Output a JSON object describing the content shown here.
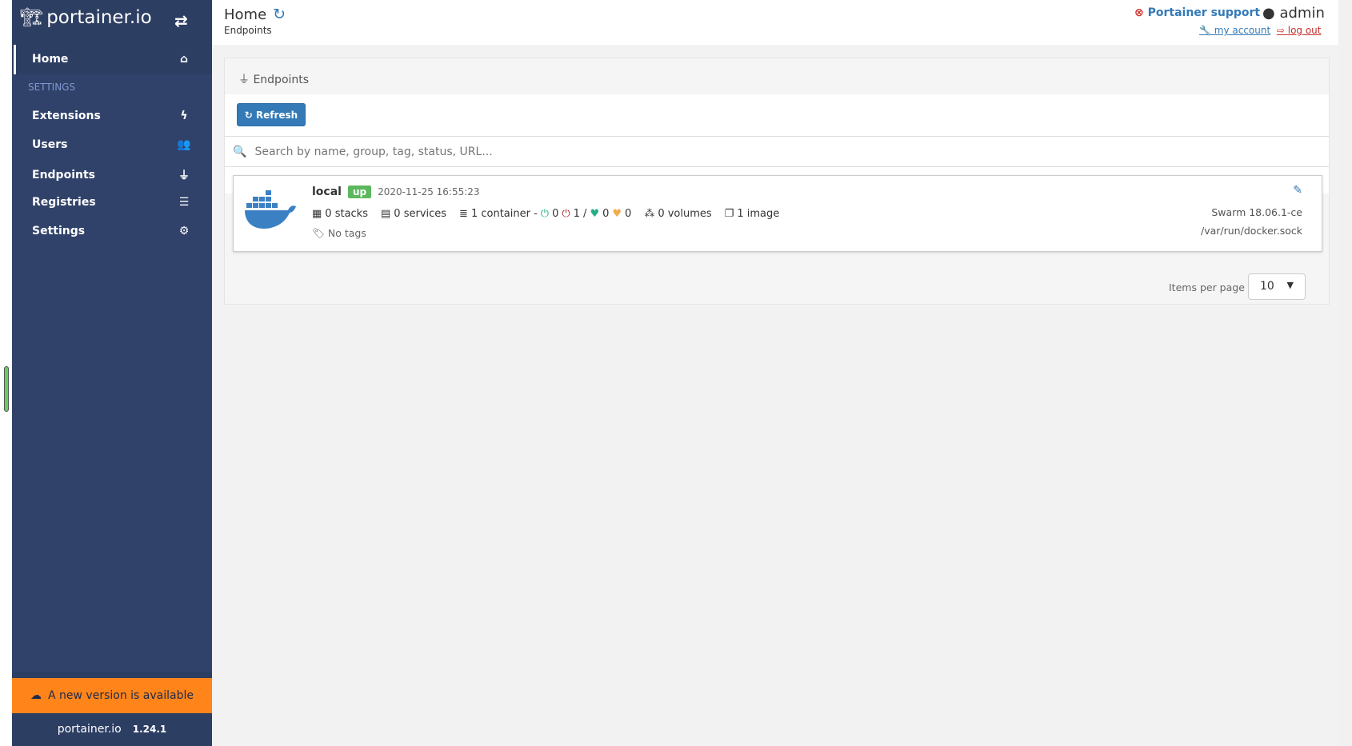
{
  "sidebar": {
    "logo": "portainer.io",
    "home": "Home",
    "section": "SETTINGS",
    "items": [
      {
        "label": "Extensions",
        "icon": "bolt-icon"
      },
      {
        "label": "Users",
        "icon": "users-icon"
      },
      {
        "label": "Endpoints",
        "icon": "plug-icon"
      },
      {
        "label": "Registries",
        "icon": "database-icon"
      },
      {
        "label": "Settings",
        "icon": "cogs-icon"
      }
    ],
    "update_banner": "A new version is available",
    "footer_logo": "portainer.io",
    "version": "1.24.1"
  },
  "header": {
    "title": "Home",
    "breadcrumb": "Endpoints",
    "support": "Portainer support",
    "user": "admin",
    "my_account": "my account",
    "log_out": "log out"
  },
  "panel": {
    "title": "Endpoints",
    "refresh": "Refresh",
    "search_placeholder": "Search by name, group, tag, status, URL...",
    "endpoint": {
      "name": "local",
      "status": "up",
      "timestamp": "2020-11-25 16:55:23",
      "stacks": "0 stacks",
      "services": "0 services",
      "containers": "1 container -",
      "running": "0",
      "stopped": "1 /",
      "healthy": "0",
      "unhealthy": "0",
      "volumes": "0 volumes",
      "images": "1 image",
      "tags": "No tags",
      "engine": "Swarm 18.06.1-ce",
      "url": "/var/run/docker.sock"
    },
    "items_per_page_label": "Items per page",
    "items_per_page": "10"
  },
  "colors": {
    "sidebar": "#2d3e63",
    "accent": "#337ab7",
    "banner": "#ff851b",
    "up": "#5cb85c"
  }
}
